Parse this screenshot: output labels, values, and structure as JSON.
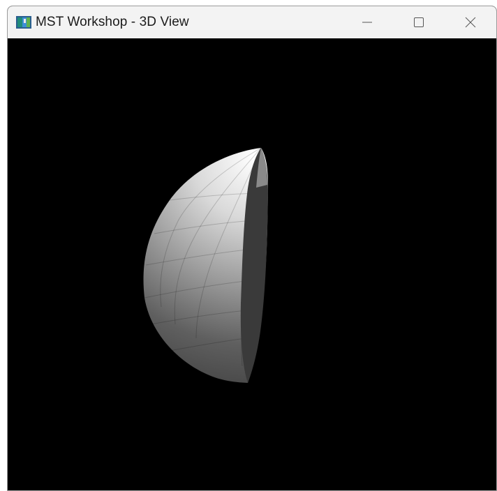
{
  "window": {
    "title": "MST Workshop - 3D View"
  },
  "controls": {
    "minimize_icon": "minimize-icon",
    "maximize_icon": "maximize-icon",
    "close_icon": "close-icon"
  },
  "viewport": {
    "background": "#000000",
    "object": "shaded-hemisphere"
  }
}
